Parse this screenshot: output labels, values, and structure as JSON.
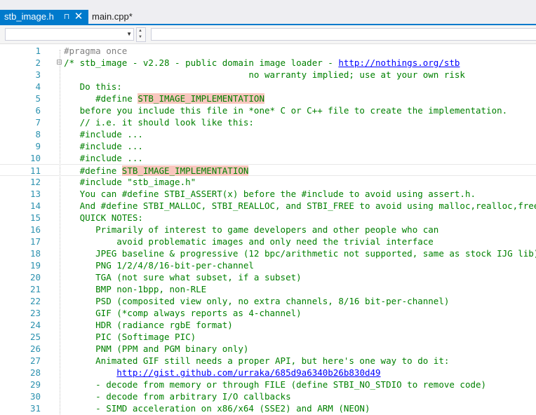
{
  "tabs": [
    {
      "label": "stb_image.h",
      "pin": "⊓",
      "close": "✕"
    },
    {
      "label": "main.cpp*"
    }
  ],
  "navbar": {
    "left_combo_value": "",
    "right_combo_value": ""
  },
  "colors": {
    "accent": "#007acc",
    "line_number": "#2b91af",
    "comment": "#008000",
    "preprocessor": "#808080",
    "highlight": "#f9c6be"
  },
  "editor": {
    "fold_marker": "−",
    "current_line": 11,
    "lines": [
      {
        "n": "1",
        "parts": [
          {
            "t": "#pragma once",
            "c": "preproc"
          }
        ]
      },
      {
        "n": "2",
        "parts": [
          {
            "t": "/* stb_image - v2.28 - public domain image loader - "
          },
          {
            "t": "http://nothings.org/stb",
            "c": "lnk"
          }
        ]
      },
      {
        "n": "3",
        "parts": [
          {
            "t": "                                   no warranty implied; use at your own risk"
          }
        ]
      },
      {
        "n": "4",
        "parts": [
          {
            "t": "   Do this:"
          }
        ]
      },
      {
        "n": "5",
        "parts": [
          {
            "t": "      #define "
          },
          {
            "t": "STB_IMAGE_IMPLEMENTATION",
            "c": "hl"
          }
        ]
      },
      {
        "n": "6",
        "parts": [
          {
            "t": "   before you include this file in *one* C or C++ file to create the implementation."
          }
        ]
      },
      {
        "n": "7",
        "parts": [
          {
            "t": "   // i.e. it should look like this:"
          }
        ]
      },
      {
        "n": "8",
        "parts": [
          {
            "t": "   #include ..."
          }
        ]
      },
      {
        "n": "9",
        "parts": [
          {
            "t": "   #include ..."
          }
        ]
      },
      {
        "n": "10",
        "parts": [
          {
            "t": "   #include ..."
          }
        ]
      },
      {
        "n": "11",
        "parts": [
          {
            "t": "   #define "
          },
          {
            "t": "STB_IMAGE_IMPLEMENTATION",
            "c": "hl"
          }
        ]
      },
      {
        "n": "12",
        "parts": [
          {
            "t": "   #include \"stb_image.h\""
          }
        ]
      },
      {
        "n": "13",
        "parts": [
          {
            "t": "   You can #define STBI_ASSERT(x) before the #include to avoid using assert.h."
          }
        ]
      },
      {
        "n": "14",
        "parts": [
          {
            "t": "   And #define STBI_MALLOC, STBI_REALLOC, and STBI_FREE to avoid using malloc,realloc,free"
          }
        ]
      },
      {
        "n": "15",
        "parts": [
          {
            "t": "   QUICK NOTES:"
          }
        ]
      },
      {
        "n": "16",
        "parts": [
          {
            "t": "      Primarily of interest to game developers and other people who can"
          }
        ]
      },
      {
        "n": "17",
        "parts": [
          {
            "t": "          avoid problematic images and only need the trivial interface"
          }
        ]
      },
      {
        "n": "18",
        "parts": [
          {
            "t": "      JPEG baseline & progressive (12 bpc/arithmetic not supported, same as stock IJG lib)"
          }
        ]
      },
      {
        "n": "19",
        "parts": [
          {
            "t": "      PNG 1/2/4/8/16-bit-per-channel"
          }
        ]
      },
      {
        "n": "20",
        "parts": [
          {
            "t": "      TGA (not sure what subset, if a subset)"
          }
        ]
      },
      {
        "n": "21",
        "parts": [
          {
            "t": "      BMP non-1bpp, non-RLE"
          }
        ]
      },
      {
        "n": "22",
        "parts": [
          {
            "t": "      PSD (composited view only, no extra channels, 8/16 bit-per-channel)"
          }
        ]
      },
      {
        "n": "23",
        "parts": [
          {
            "t": "      GIF (*comp always reports as 4-channel)"
          }
        ]
      },
      {
        "n": "24",
        "parts": [
          {
            "t": "      HDR (radiance rgbE format)"
          }
        ]
      },
      {
        "n": "25",
        "parts": [
          {
            "t": "      PIC (Softimage PIC)"
          }
        ]
      },
      {
        "n": "26",
        "parts": [
          {
            "t": "      PNM (PPM and PGM binary only)"
          }
        ]
      },
      {
        "n": "27",
        "parts": [
          {
            "t": "      Animated GIF still needs a proper API, but here's one way to do it:"
          }
        ]
      },
      {
        "n": "28",
        "parts": [
          {
            "t": "          "
          },
          {
            "t": "http://gist.github.com/urraka/685d9a6340b26b830d49",
            "c": "lnk"
          }
        ]
      },
      {
        "n": "29",
        "parts": [
          {
            "t": "      - decode from memory or through FILE (define STBI_NO_STDIO to remove code)"
          }
        ]
      },
      {
        "n": "30",
        "parts": [
          {
            "t": "      - decode from arbitrary I/O callbacks"
          }
        ]
      },
      {
        "n": "31",
        "parts": [
          {
            "t": "      - SIMD acceleration on x86/x64 (SSE2) and ARM (NEON)"
          }
        ]
      }
    ]
  }
}
